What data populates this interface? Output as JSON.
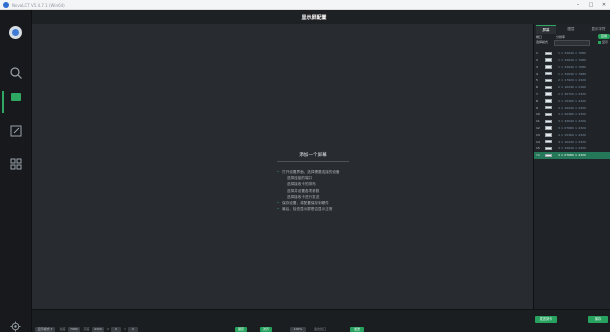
{
  "window": {
    "title": "NovaLCT  V5.4.7.1  (Win64)",
    "minimize": "–",
    "maximize": "□",
    "close": "✕"
  },
  "canvas_title": "显示屏配置",
  "sidebar": {
    "items": [
      {
        "icon": "app-logo-icon"
      },
      {
        "icon": "search-icon"
      },
      {
        "icon": "screen-icon",
        "active": true
      },
      {
        "icon": "edit-icon"
      },
      {
        "icon": "grid-icon"
      },
      {
        "icon": "settings-gear-icon"
      }
    ]
  },
  "steps": {
    "heading": "添加一个屏幕",
    "rows": [
      {
        "text": "打开设置界面，选择需要连接的设备",
        "bullet": true
      },
      {
        "text": "选择连接的端口",
        "bullet": false
      },
      {
        "text": "选择接收卡的排布",
        "bullet": false
      },
      {
        "text": "选择并设置各项参数",
        "bullet": false
      },
      {
        "text": "选择接收卡进行发送",
        "bullet": false
      },
      {
        "text": "保存设置，将配置保存到硬件",
        "bullet": true
      },
      {
        "text": "最后，检查显示屏是否显示正常",
        "bullet": true
      }
    ]
  },
  "right_panel": {
    "tabs": [
      "屏幕",
      "图层",
      "显示字符"
    ],
    "sub_label_1": "端口",
    "sub_label_2": "分辨率",
    "select_label": "选择模式",
    "apply_label": "应用",
    "checkbox_label": "显示",
    "items": [
      {
        "num": "1",
        "res": "1 × 32640 × 7680"
      },
      {
        "num": "2",
        "res": "1 × 32640 × 7680"
      },
      {
        "num": "3",
        "res": "1 × 32640 × 7680"
      },
      {
        "num": "4",
        "res": "1 × 32640 × 7680"
      },
      {
        "num": "5",
        "res": "2 × 17920 × 4320"
      },
      {
        "num": "6",
        "res": "2 × 10240 × 2160"
      },
      {
        "num": "7",
        "res": "2 × 30720 × 4320"
      },
      {
        "num": "8",
        "res": "2 × 15360 × 4320"
      },
      {
        "num": "9",
        "res": "3 × 10240 × 4320"
      },
      {
        "num": "10",
        "res": "3 × 20480 × 4320"
      },
      {
        "num": "11",
        "res": "3 × 32640 × 4320"
      },
      {
        "num": "12",
        "res": "3 × 07680 × 4320"
      },
      {
        "num": "13",
        "res": "4 × 15360 × 4320"
      },
      {
        "num": "14",
        "res": "4 × 10240 × 4320"
      },
      {
        "num": "15",
        "res": "4 × 32640 × 4320"
      },
      {
        "num": "16",
        "res": "4 × 07680 × 4320",
        "selected": true
      }
    ],
    "btn_left": "发送到卡",
    "btn_right": "保存"
  },
  "bottombar": {
    "items": [
      {
        "label": "显示模式 ▾",
        "style": "box"
      },
      {
        "label": "宽度",
        "style": "label"
      },
      {
        "label": "7680",
        "style": "box"
      },
      {
        "label": "高度",
        "style": "label"
      },
      {
        "label": "4320",
        "style": "box"
      },
      {
        "label": "X",
        "style": "label"
      },
      {
        "label": "0",
        "style": "box"
      },
      {
        "label": "Y",
        "style": "label"
      },
      {
        "label": "0",
        "style": "box"
      },
      {
        "label": "锁定",
        "style": "green"
      },
      {
        "label": "对齐",
        "style": "green"
      },
      {
        "label": "100%",
        "style": "box"
      },
      {
        "label": "适合窗口",
        "style": "label"
      },
      {
        "label": "发送",
        "style": "green"
      }
    ]
  },
  "colors": {
    "accent_green": "#28a35f",
    "selected_row": "#25775a",
    "background": "#1e2124"
  }
}
